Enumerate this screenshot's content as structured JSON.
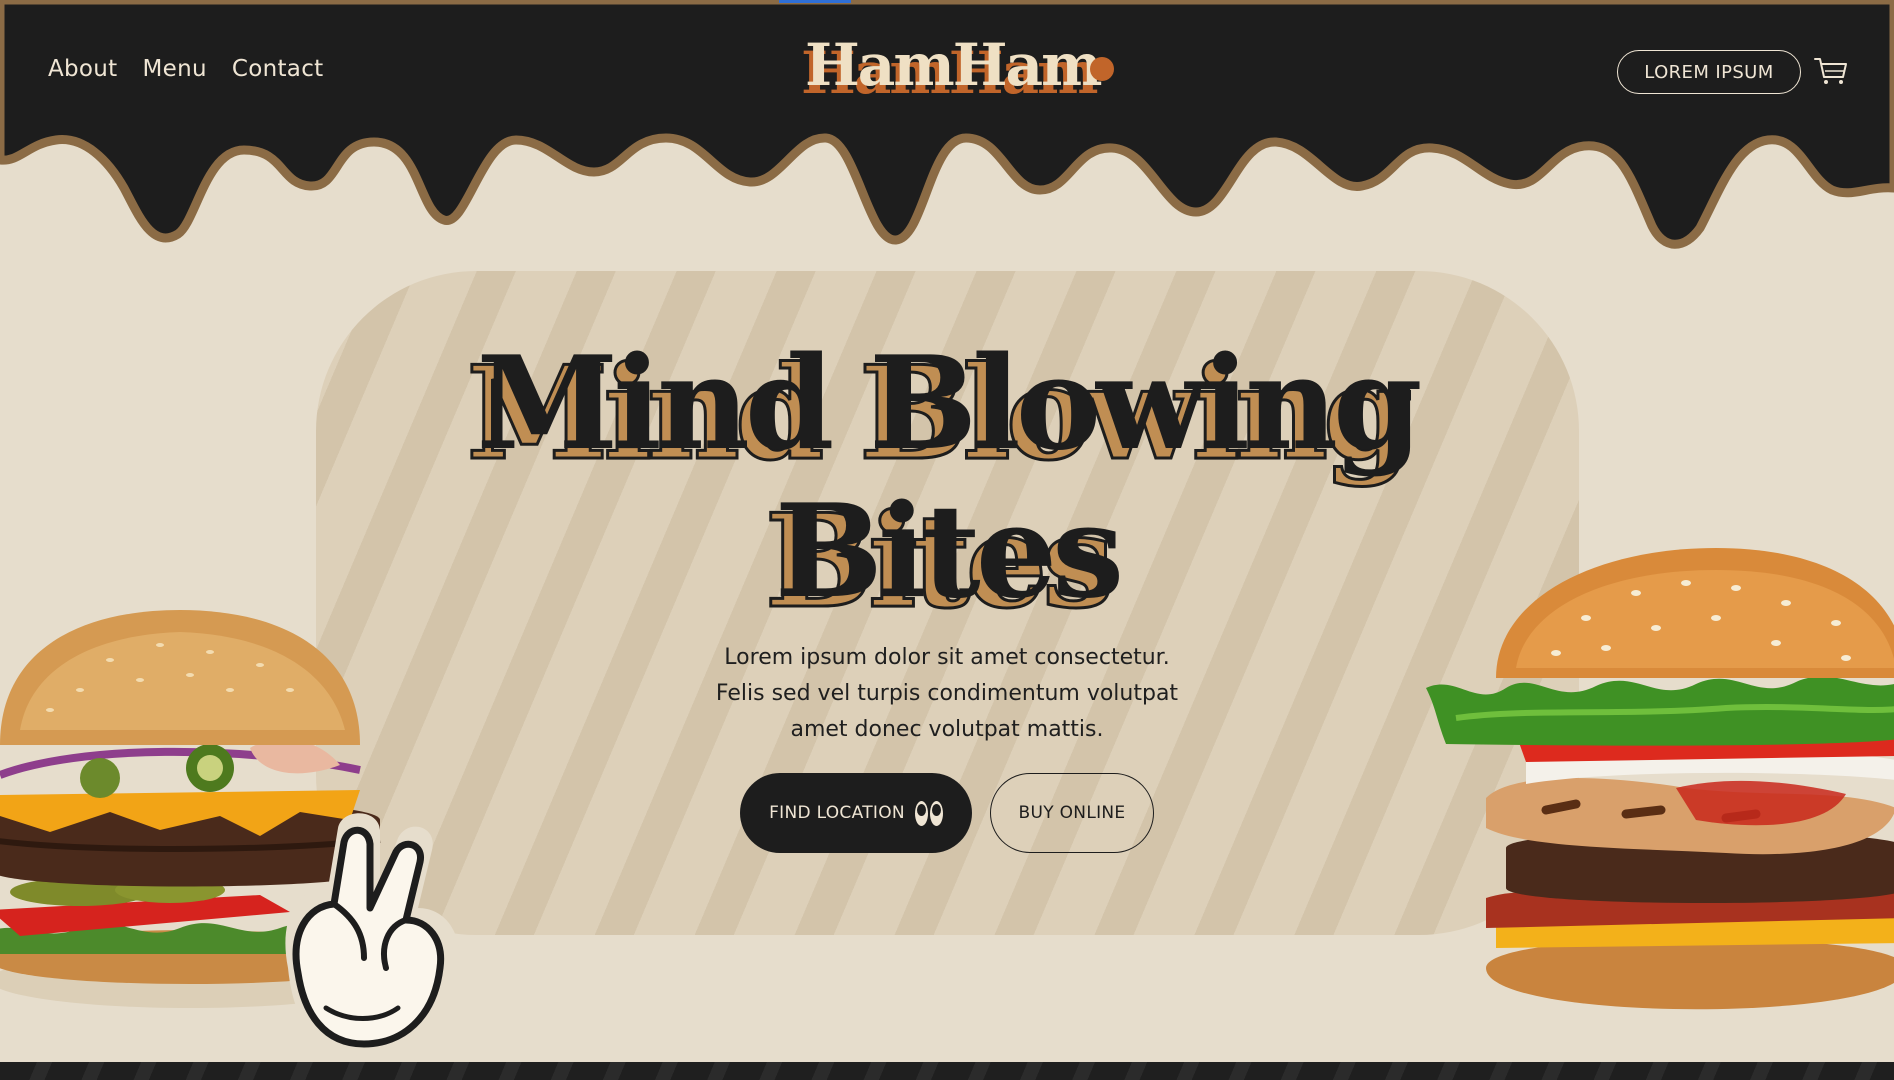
{
  "nav": {
    "links": [
      "About",
      "Menu",
      "Contact"
    ]
  },
  "brand": {
    "name": "HamHam"
  },
  "header": {
    "cta_label": "LOREM IPSUM"
  },
  "hero": {
    "headline_line1": "Mind Blowing",
    "headline_line2": "Bites",
    "lead_line1": "Lorem ipsum dolor sit amet consectetur.",
    "lead_line2": "Felis sed vel turpis condimentum volutpat",
    "lead_line3": "amet donec volutpat mattis.",
    "primary_button": "FIND LOCATION",
    "secondary_button": "BUY ONLINE"
  },
  "icons": {
    "cart": "cart-icon",
    "eyes": "eyes-icon",
    "hand": "peace-hand-icon"
  },
  "colors": {
    "header_bg": "#1d1d1d",
    "page_bg": "#e6ddcc",
    "drip_outline": "#8b6b45",
    "accent_orange": "#c1652a",
    "headline_shadow": "#c08e53"
  }
}
